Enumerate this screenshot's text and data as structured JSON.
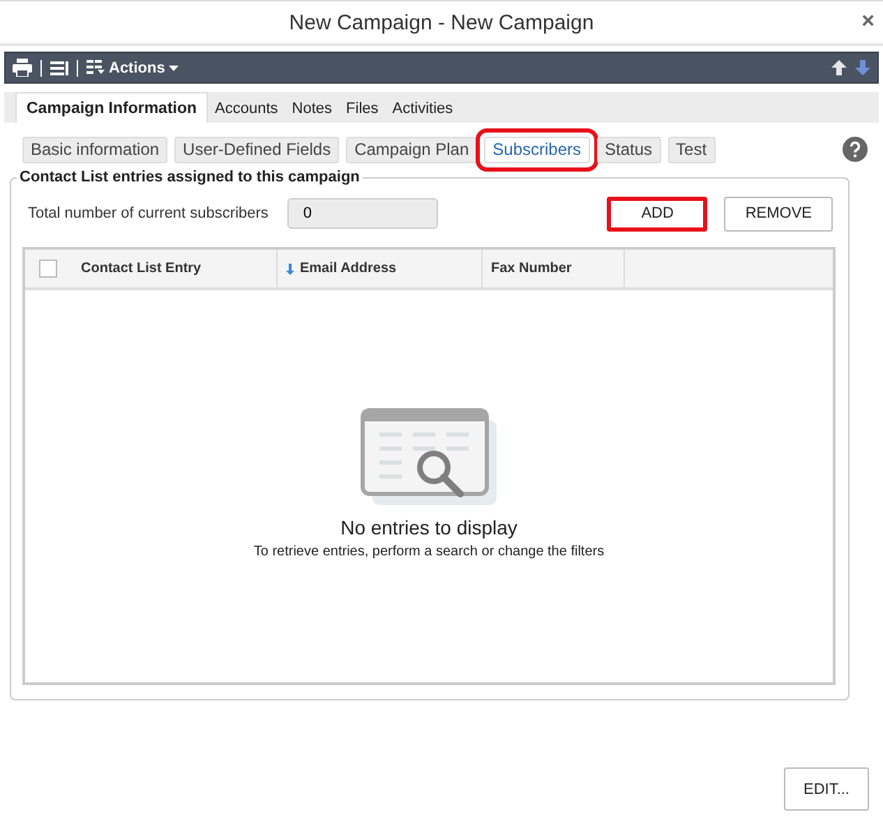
{
  "window": {
    "title": "New Campaign - New Campaign",
    "close": "×"
  },
  "toolbar": {
    "actions_label": "Actions"
  },
  "tabs": [
    {
      "label": "Campaign Information",
      "selected": true
    },
    {
      "label": "Accounts",
      "selected": false
    },
    {
      "label": "Notes",
      "selected": false
    },
    {
      "label": "Files",
      "selected": false
    },
    {
      "label": "Activities",
      "selected": false
    }
  ],
  "subtabs": [
    {
      "label": "Basic information",
      "selected": false,
      "highlighted": false
    },
    {
      "label": "User-Defined Fields",
      "selected": false,
      "highlighted": false
    },
    {
      "label": "Campaign Plan",
      "selected": false,
      "highlighted": false
    },
    {
      "label": "Subscribers",
      "selected": true,
      "highlighted": true
    },
    {
      "label": "Status",
      "selected": false,
      "highlighted": false
    },
    {
      "label": "Test",
      "selected": false,
      "highlighted": false
    }
  ],
  "group": {
    "legend": "Contact List entries assigned to this campaign",
    "total_label": "Total number of current subscribers",
    "total_value": "0",
    "buttons": [
      {
        "label": "ADD",
        "highlighted": true
      },
      {
        "label": "REMOVE",
        "highlighted": false
      }
    ],
    "table": {
      "select_all_checked": false,
      "columns": [
        {
          "label": "Contact List Entry",
          "sorted": false
        },
        {
          "label": "Email Address",
          "sorted": true
        },
        {
          "label": "Fax Number",
          "sorted": false
        }
      ],
      "empty_title": "No entries to display",
      "empty_hint": "To retrieve entries, perform a search or change the filters"
    }
  },
  "footer_button": "EDIT..."
}
